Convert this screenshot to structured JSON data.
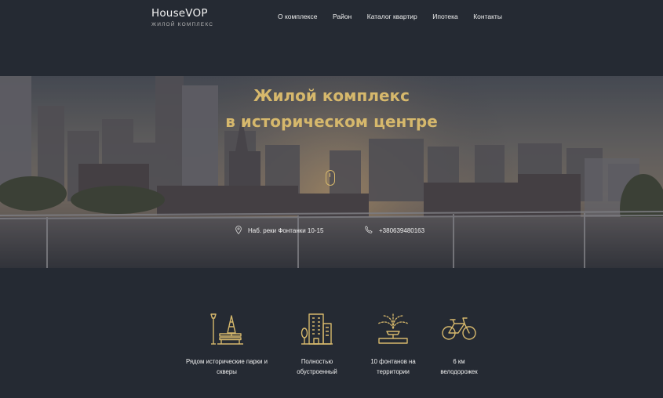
{
  "brand": {
    "name": "HouseVOP",
    "tagline": "ЖИЛОЙ КОМПЛЕКС"
  },
  "nav": [
    {
      "label": "О комплексе"
    },
    {
      "label": "Район"
    },
    {
      "label": "Каталог квартир"
    },
    {
      "label": "Ипотека"
    },
    {
      "label": "Контакты"
    }
  ],
  "hero": {
    "title_line1": "Жилой комплекс",
    "title_line2": "в историческом центре",
    "address": "Наб. реки Фонтанки 10-15",
    "phone": "+380639480163",
    "icons": {
      "address": "map-pin-icon",
      "phone": "phone-icon",
      "scroll": "mouse-scroll-icon"
    }
  },
  "features": [
    {
      "icon": "park-bench-icon",
      "line1": "Рядом исторические парки и",
      "line2": "скверы"
    },
    {
      "icon": "buildings-icon",
      "line1": "Полностью",
      "line2": "обустроенный"
    },
    {
      "icon": "fountain-icon",
      "line1": "10 фонтанов на",
      "line2": "территории"
    },
    {
      "icon": "bicycle-icon",
      "line1": "6 км",
      "line2": "велодорожек"
    }
  ],
  "colors": {
    "background": "#252a33",
    "accent": "#d6b86c",
    "text": "#f1f1f1"
  }
}
